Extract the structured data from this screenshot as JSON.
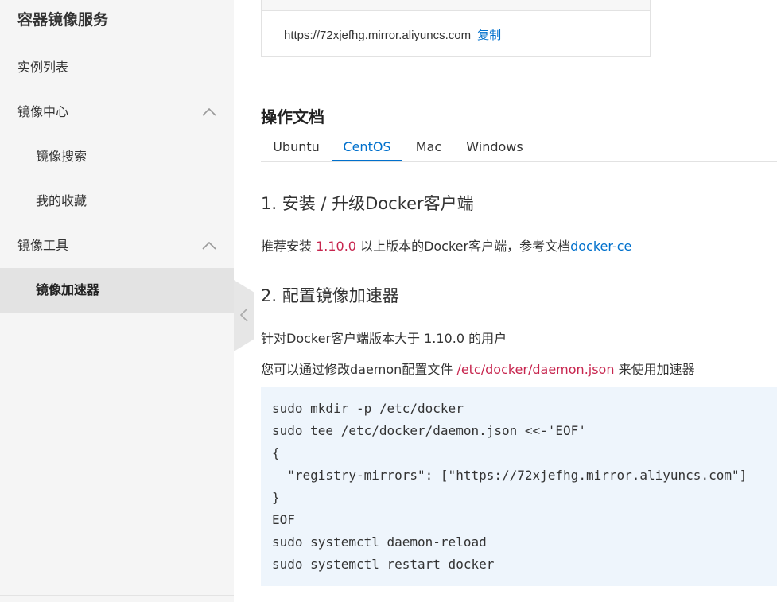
{
  "sidebar": {
    "title": "容器镜像服务",
    "items": [
      {
        "label": "实例列表"
      },
      {
        "label": "镜像中心"
      },
      {
        "label": "镜像搜索"
      },
      {
        "label": "我的收藏"
      },
      {
        "label": "镜像工具"
      },
      {
        "label": "镜像加速器"
      }
    ]
  },
  "mirror_box": {
    "url": "https://72xjefhg.mirror.aliyuncs.com",
    "copy_label": "复制"
  },
  "docs": {
    "title": "操作文档",
    "tabs": [
      {
        "label": "Ubuntu"
      },
      {
        "label": "CentOS"
      },
      {
        "label": "Mac"
      },
      {
        "label": "Windows"
      }
    ],
    "active_tab": "CentOS"
  },
  "step1": {
    "heading": "1. 安装 / 升级Docker客户端",
    "text_before": "推荐安装 ",
    "version": "1.10.0",
    "text_after": " 以上版本的Docker客户端，参考文档",
    "link": "docker-ce"
  },
  "step2": {
    "heading": "2. 配置镜像加速器",
    "users_text": "针对Docker客户端版本大于 1.10.0 的用户",
    "modify_before": "您可以通过修改daemon配置文件 ",
    "config_path": "/etc/docker/daemon.json",
    "modify_after": " 来使用加速器"
  },
  "code": [
    "sudo mkdir -p /etc/docker",
    "sudo tee /etc/docker/daemon.json <<-'EOF'",
    "{",
    "  \"registry-mirrors\": [\"https://72xjefhg.mirror.aliyuncs.com\"]",
    "}",
    "EOF",
    "sudo systemctl daemon-reload",
    "sudo systemctl restart docker"
  ],
  "colors": {
    "accent": "#0070cc",
    "highlight_red": "#c7254e",
    "code_bg": "#eef5fc",
    "sidebar_bg": "#f5f5f5",
    "active_item_bg": "#e3e3e3"
  },
  "icons": {
    "expand": "chevron-up-icon",
    "collapse_sidebar": "chevron-left-icon"
  }
}
